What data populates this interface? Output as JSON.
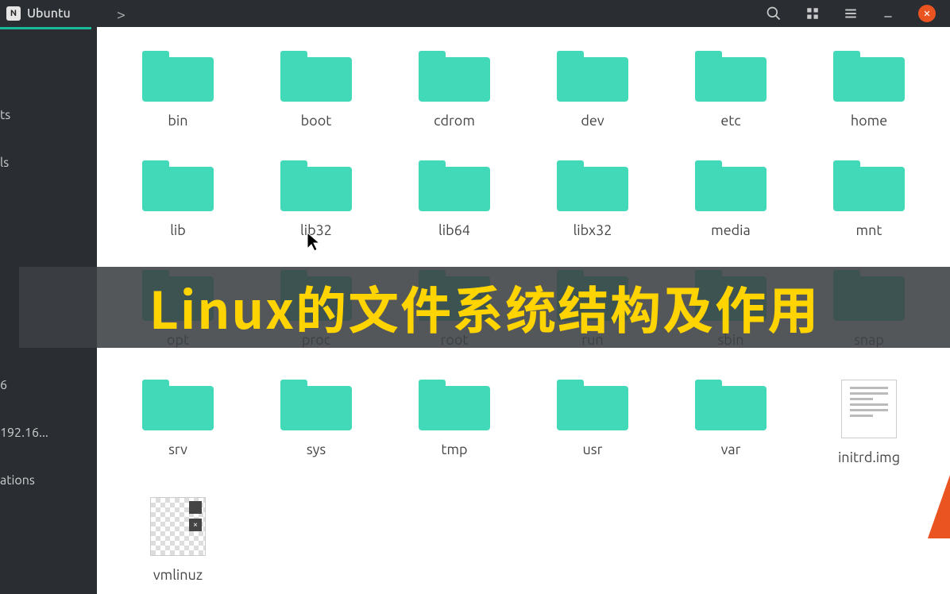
{
  "titlebar": {
    "app_title": "Ubuntu",
    "nav_forward": ">"
  },
  "sidebar": {
    "items": [
      {
        "label": "ts"
      },
      {
        "label": "ls"
      },
      {
        "label": "6"
      },
      {
        "label": "192.16..."
      },
      {
        "label": "ations"
      }
    ]
  },
  "files": [
    {
      "name": "bin",
      "type": "folder"
    },
    {
      "name": "boot",
      "type": "folder"
    },
    {
      "name": "cdrom",
      "type": "folder"
    },
    {
      "name": "dev",
      "type": "folder"
    },
    {
      "name": "etc",
      "type": "folder"
    },
    {
      "name": "home",
      "type": "folder"
    },
    {
      "name": "lib",
      "type": "folder"
    },
    {
      "name": "lib32",
      "type": "folder"
    },
    {
      "name": "lib64",
      "type": "folder"
    },
    {
      "name": "libx32",
      "type": "folder"
    },
    {
      "name": "media",
      "type": "folder"
    },
    {
      "name": "mnt",
      "type": "folder"
    },
    {
      "name": "opt",
      "type": "folder"
    },
    {
      "name": "proc",
      "type": "folder"
    },
    {
      "name": "root",
      "type": "folder"
    },
    {
      "name": "run",
      "type": "folder"
    },
    {
      "name": "sbin",
      "type": "folder"
    },
    {
      "name": "snap",
      "type": "folder"
    },
    {
      "name": "srv",
      "type": "folder"
    },
    {
      "name": "sys",
      "type": "folder"
    },
    {
      "name": "tmp",
      "type": "folder"
    },
    {
      "name": "usr",
      "type": "folder"
    },
    {
      "name": "var",
      "type": "folder"
    },
    {
      "name": "initrd.img",
      "type": "file"
    },
    {
      "name": "vmlinuz",
      "type": "image"
    }
  ],
  "banner": {
    "text": "Linux的文件系统结构及作用"
  },
  "img_badge2": "×"
}
